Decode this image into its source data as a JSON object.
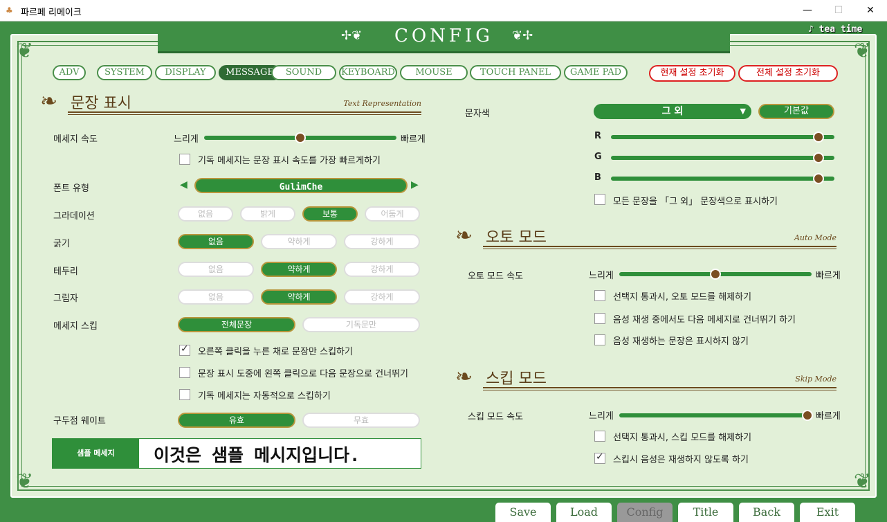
{
  "window": {
    "title": "파르페 리메이크",
    "min": "—",
    "max": "☐",
    "close": "✕"
  },
  "banner": {
    "title": "CONFIG",
    "orn_left": "✢❦",
    "orn_right": "❦✢",
    "tea": "♪ tea time"
  },
  "tabs": [
    {
      "label": "ADV",
      "active": false
    },
    {
      "label": "SYSTEM",
      "active": false
    },
    {
      "label": "DISPLAY",
      "active": false
    },
    {
      "label": "MESSAGE",
      "active": true
    },
    {
      "label": "SOUND",
      "active": false
    },
    {
      "label": "KEYBOARD",
      "active": false
    },
    {
      "label": "MOUSE",
      "active": false
    },
    {
      "label": "TOUCH PANEL",
      "active": false
    },
    {
      "label": "GAME PAD",
      "active": false
    }
  ],
  "reset": {
    "current": "현재 설정 초기화",
    "all": "전체 설정 초기화"
  },
  "left": {
    "header": {
      "label": "문장 표시",
      "sub": "Text Representation"
    },
    "msg_speed": {
      "label": "메세지 속도",
      "slow": "느리게",
      "fast": "빠르게",
      "value": 0.5
    },
    "read_fast": {
      "label": "기독 메세지는 문장 표시 속도를 가장 빠르게하기",
      "checked": false
    },
    "font": {
      "label": "폰트 유형",
      "value": "GulimChe"
    },
    "gradation": {
      "label": "그라데이션",
      "options": [
        "없음",
        "밝게",
        "보통",
        "어둡게"
      ],
      "selected": 2
    },
    "weight": {
      "label": "굵기",
      "options": [
        "없음",
        "약하게",
        "강하게"
      ],
      "selected": 0
    },
    "border": {
      "label": "테두리",
      "options": [
        "없음",
        "약하게",
        "강하게"
      ],
      "selected": 1
    },
    "shadow": {
      "label": "그림자",
      "options": [
        "없음",
        "약하게",
        "강하게"
      ],
      "selected": 1
    },
    "skip": {
      "label": "메세지 스킵",
      "options": [
        "전체문장",
        "기독문만"
      ],
      "selected": 0
    },
    "cb1": {
      "label": "오른쪽 클릭을 누른 채로 문장만 스킵하기",
      "checked": true
    },
    "cb2": {
      "label": "문장 표시 도중에 왼쪽 클릭으로 다음 문장으로 건너뛰기",
      "checked": false
    },
    "cb3": {
      "label": "기독 메세지는 자동적으로 스킵하기",
      "checked": false
    },
    "punct": {
      "label": "구두점 웨이트",
      "options": [
        "유효",
        "무효"
      ],
      "selected": 0
    },
    "sample": {
      "label": "샘플 메세지",
      "text": "이것은 샘플 메시지입니다."
    }
  },
  "right": {
    "color": {
      "label": "문자색",
      "value": "그 외",
      "default_btn": "기본값",
      "r": "R",
      "g": "G",
      "b": "B",
      "r_val": 0.93,
      "g_val": 0.93,
      "b_val": 0.93
    },
    "color_cb": {
      "label": "모든 문장을 「그 외」 문장색으로 표시하기",
      "checked": false
    },
    "auto": {
      "header": {
        "label": "오토 모드",
        "sub": "Auto Mode"
      },
      "speed": {
        "label": "오토 모드 속도",
        "slow": "느리게",
        "fast": "빠르게",
        "value": 0.5
      },
      "cb1": {
        "label": "선택지 통과시, 오토 모드를 해제하기",
        "checked": false
      },
      "cb2": {
        "label": "음성 재생 중에서도 다음 메세지로 건너뛰기 하기",
        "checked": false
      },
      "cb3": {
        "label": "음성 재생하는 문장은 표시하지 않기",
        "checked": false
      }
    },
    "skipmode": {
      "header": {
        "label": "스킵 모드",
        "sub": "Skip Mode"
      },
      "speed": {
        "label": "스킵 모드 속도",
        "slow": "느리게",
        "fast": "빠르게",
        "value": 0.98
      },
      "cb1": {
        "label": "선택지 통과시, 스킵 모드를 해제하기",
        "checked": false
      },
      "cb2": {
        "label": "스킵시 음성은 재생하지 않도록 하기",
        "checked": true
      }
    }
  },
  "nav": [
    "Save",
    "Load",
    "Config",
    "Title",
    "Back",
    "Exit"
  ],
  "nav_active": 2
}
